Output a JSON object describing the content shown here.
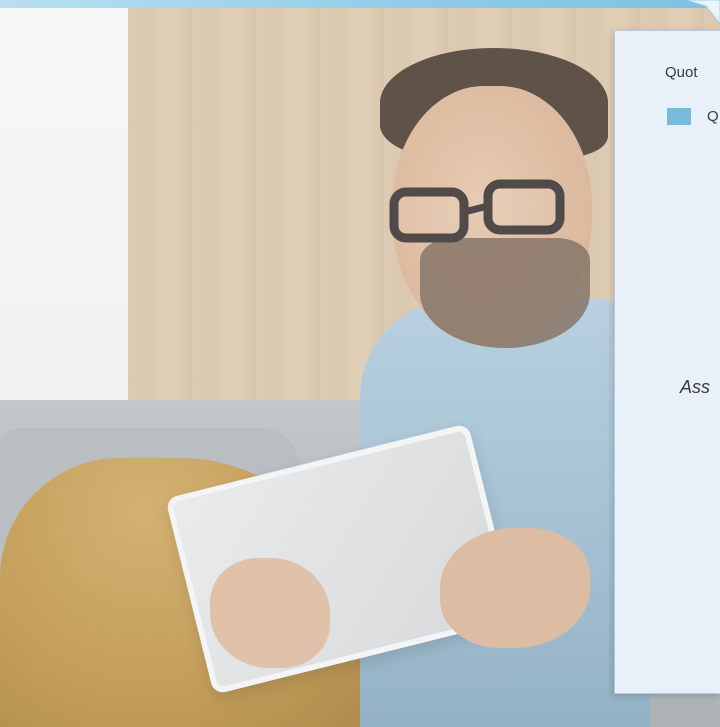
{
  "header_bar": {
    "color": "#8fcbe8"
  },
  "background_photo": {
    "description_icon": "man-with-tablet-photo"
  },
  "card": {
    "title": "Quot",
    "legend": {
      "swatch_color": "#7ab8dd",
      "label": "Q"
    },
    "assumption_text": "Ass"
  }
}
